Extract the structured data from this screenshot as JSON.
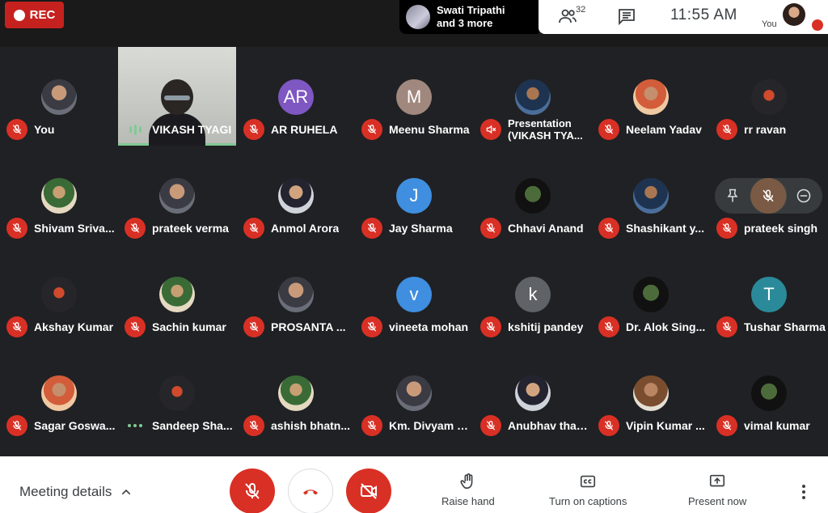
{
  "topbar": {
    "rec_label": "REC",
    "presenter_line1": "Swati Tripathi",
    "presenter_line2": "and 3 more",
    "people_count": "32",
    "clock": "11:55  AM",
    "you_label": "You"
  },
  "colors": {
    "muted_red": "#d93025",
    "speaking_green": "#81c995",
    "bg": "#202124"
  },
  "participants": [
    {
      "name": "You",
      "initial": "",
      "avatar_color": "",
      "status": "muted"
    },
    {
      "name": "VIKASH TYAGI",
      "initial": "",
      "avatar_color": "",
      "status": "speaking"
    },
    {
      "name": "AR RUHELA",
      "initial": "AR",
      "avatar_color": "#7e57c2",
      "status": "muted"
    },
    {
      "name": "Meenu Sharma",
      "initial": "M",
      "avatar_color": "#a1887f",
      "status": "muted"
    },
    {
      "name": "Presentation (VIKASH TYA...",
      "initial": "",
      "avatar_color": "",
      "status": "volume-off"
    },
    {
      "name": "Neelam Yadav",
      "initial": "",
      "avatar_color": "",
      "status": "muted"
    },
    {
      "name": "rr ravan",
      "initial": "",
      "avatar_color": "",
      "status": "muted"
    },
    {
      "name": "Shivam Sriva...",
      "initial": "",
      "avatar_color": "",
      "status": "muted"
    },
    {
      "name": "prateek verma",
      "initial": "",
      "avatar_color": "",
      "status": "muted"
    },
    {
      "name": "Anmol Arora",
      "initial": "",
      "avatar_color": "",
      "status": "muted"
    },
    {
      "name": "Jay Sharma",
      "initial": "J",
      "avatar_color": "#3f8ee0",
      "status": "muted"
    },
    {
      "name": "Chhavi Anand",
      "initial": "",
      "avatar_color": "",
      "status": "muted"
    },
    {
      "name": "Shashikant y...",
      "initial": "",
      "avatar_color": "",
      "status": "muted"
    },
    {
      "name": "prateek singh",
      "initial": "",
      "avatar_color": "",
      "status": "muted"
    },
    {
      "name": "Akshay Kumar",
      "initial": "",
      "avatar_color": "",
      "status": "muted"
    },
    {
      "name": "Sachin kumar",
      "initial": "",
      "avatar_color": "",
      "status": "muted"
    },
    {
      "name": "PROSANTA ...",
      "initial": "",
      "avatar_color": "",
      "status": "muted"
    },
    {
      "name": "vineeta mohan",
      "initial": "v",
      "avatar_color": "#3f8ee0",
      "status": "muted"
    },
    {
      "name": "kshitij pandey",
      "initial": "k",
      "avatar_color": "#5f6368",
      "status": "muted"
    },
    {
      "name": "Dr. Alok Sing...",
      "initial": "",
      "avatar_color": "",
      "status": "muted"
    },
    {
      "name": "Tushar Sharma",
      "initial": "T",
      "avatar_color": "#2b8a9a",
      "status": "muted"
    },
    {
      "name": "Sagar Goswa...",
      "initial": "",
      "avatar_color": "",
      "status": "muted"
    },
    {
      "name": "Sandeep Sha...",
      "initial": "",
      "avatar_color": "",
      "status": "unmuted"
    },
    {
      "name": "ashish bhatn...",
      "initial": "",
      "avatar_color": "",
      "status": "muted"
    },
    {
      "name": "Km. Divyam S...",
      "initial": "",
      "avatar_color": "",
      "status": "muted"
    },
    {
      "name": "Anubhav thak...",
      "initial": "",
      "avatar_color": "",
      "status": "muted"
    },
    {
      "name": "Vipin Kumar ...",
      "initial": "",
      "avatar_color": "",
      "status": "muted"
    },
    {
      "name": "vimal kumar",
      "initial": "",
      "avatar_color": "",
      "status": "muted"
    }
  ],
  "bottombar": {
    "meeting_details": "Meeting details",
    "raise_hand": "Raise hand",
    "captions": "Turn on captions",
    "present": "Present now"
  }
}
